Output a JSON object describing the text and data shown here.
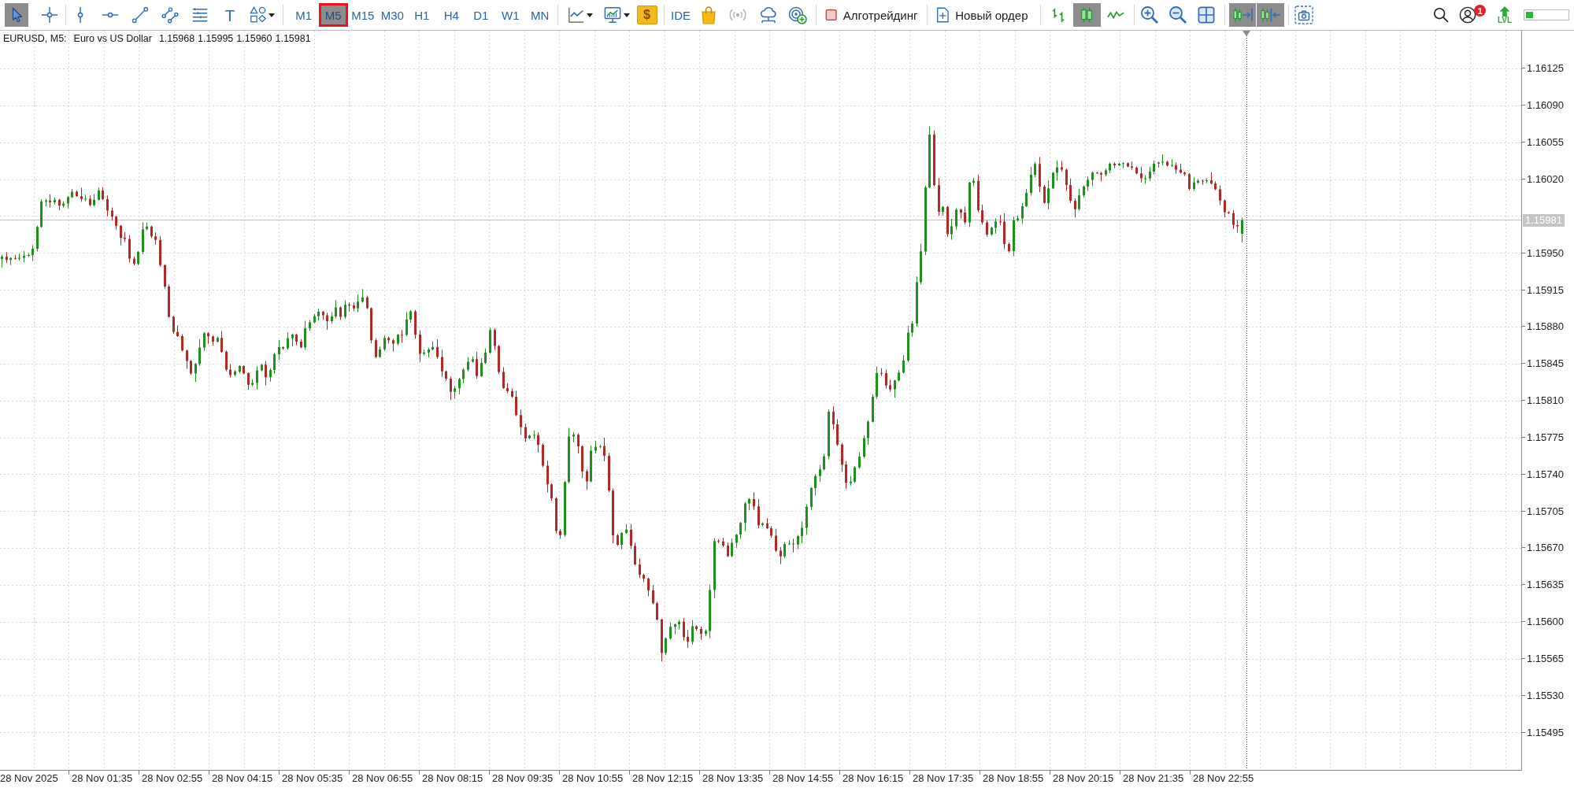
{
  "toolbar": {
    "navigation_tools": [
      {
        "kind": "cursor",
        "selected": true
      },
      {
        "kind": "crosshair",
        "selected": false
      }
    ],
    "drawing_tools": [
      {
        "kind": "vertical-line",
        "selected": false
      },
      {
        "kind": "horizontal-line",
        "selected": false
      },
      {
        "kind": "trend-line",
        "selected": false
      },
      {
        "kind": "channel",
        "selected": false
      },
      {
        "kind": "levels",
        "selected": false
      },
      {
        "kind": "text",
        "label": "T",
        "selected": false
      },
      {
        "kind": "shapes",
        "selected": false
      }
    ],
    "timeframes": [
      {
        "label": "M1",
        "selected": false,
        "highlighted": false
      },
      {
        "label": "M5",
        "selected": true,
        "highlighted": true
      },
      {
        "label": "M15",
        "selected": false,
        "highlighted": false
      },
      {
        "label": "M30",
        "selected": false,
        "highlighted": false
      },
      {
        "label": "H1",
        "selected": false,
        "highlighted": false
      },
      {
        "label": "H4",
        "selected": false,
        "highlighted": false
      },
      {
        "label": "D1",
        "selected": false,
        "highlighted": false
      },
      {
        "label": "W1",
        "selected": false,
        "highlighted": false
      },
      {
        "label": "MN",
        "selected": false,
        "highlighted": false
      }
    ],
    "dollar_button": {
      "label": "$"
    },
    "ide_button": {
      "label": "IDE"
    },
    "signals_button": {
      "disabled": true
    },
    "algo_trading": {
      "label": "Алготрейдинг",
      "on": false
    },
    "new_order": {
      "label": "Новый ордер"
    },
    "chart_types": [
      {
        "kind": "bars",
        "selected": false
      },
      {
        "kind": "candles",
        "selected": true
      },
      {
        "kind": "line",
        "selected": false
      }
    ],
    "autoscroll": {
      "on": true
    },
    "chart_shift": {
      "on": true
    },
    "notifications": {
      "count": "1"
    },
    "level": {
      "label": "LVL",
      "level": 0.17
    }
  },
  "chart": {
    "symbol": "EURUSD, M5:",
    "description": "Euro vs US Dollar",
    "ohlc": [
      "1.15968",
      "1.15995",
      "1.15960",
      "1.15981"
    ],
    "price_scale_upper": [
      "1.16125",
      "1.16090",
      "1.16055",
      "1.16020"
    ],
    "current_price": "1.15981",
    "price_scale_lower": [
      "1.15950",
      "1.15915",
      "1.15880",
      "1.15845",
      "1.15810",
      "1.15775",
      "1.15740",
      "1.15705",
      "1.15670",
      "1.15635",
      "1.15600",
      "1.15565",
      "1.15530",
      "1.15495"
    ],
    "time_scale": [
      "28 Nov 2025",
      "28 Nov 01:35",
      "28 Nov 02:55",
      "28 Nov 04:15",
      "28 Nov 05:35",
      "28 Nov 06:55",
      "28 Nov 08:15",
      "28 Nov 09:35",
      "28 Nov 10:55",
      "28 Nov 12:15",
      "28 Nov 13:35",
      "28 Nov 14:55",
      "28 Nov 16:15",
      "28 Nov 17:35",
      "28 Nov 18:55",
      "28 Nov 20:15",
      "28 Nov 21:35",
      "28 Nov 22:55"
    ]
  }
}
